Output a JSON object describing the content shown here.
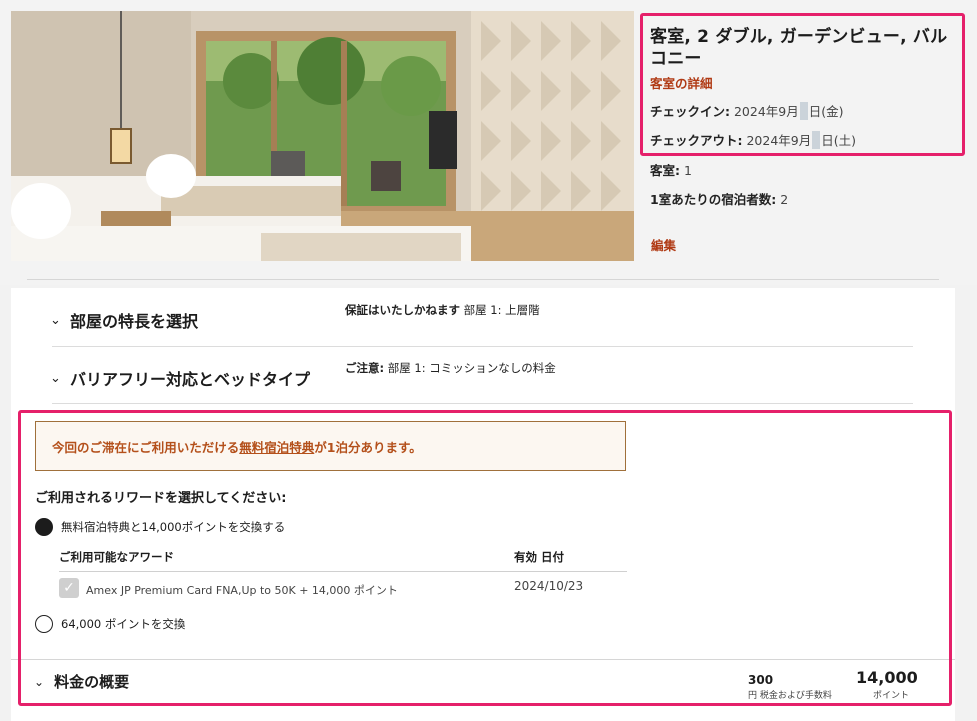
{
  "room": {
    "title": "客室, 2 ダブル, ガーデンビュー, バルコニー",
    "details_link": "客室の詳細",
    "checkin_label": "チェックイン:",
    "checkin_value_a": "2024年9月",
    "checkin_value_b": "日(金)",
    "checkout_label": "チェックアウト:",
    "checkout_value_a": "2024年9月",
    "checkout_value_b": "日(土)",
    "rooms_label": "客室:",
    "rooms_value": "1",
    "guests_label": "1室あたりの宿泊者数:",
    "guests_value": "2",
    "edit_link": "編集"
  },
  "accordion": {
    "features_title": "部屋の特長を選択",
    "features_note_label": "保証はいたしかねます",
    "features_note_value": "部屋 1: 上層階",
    "accessibility_title": "バリアフリー対応とベッドタイプ",
    "accessibility_note_label": "ご注意:",
    "accessibility_note_value": "部屋 1: コミッションなしの料金"
  },
  "rewards": {
    "notice_prefix": "今回のご滞在にご利用いただける",
    "notice_link": "無料宿泊特典",
    "notice_suffix": "が1泊分あります。",
    "question": "ご利用されるリワードを選択してください:",
    "option1_label": "無料宿泊特典と14,000ポイントを交換する",
    "option1_selected": true,
    "awards_header": "ご利用可能なアワード",
    "expiry_header": "有効 日付",
    "award_name": "Amex JP Premium Card FNA,Up to 50K + 14,000 ポイント",
    "award_expiry": "2024/10/23",
    "option2_label": "64,000 ポイントを交換",
    "option2_selected": false
  },
  "summary": {
    "title": "料金の概要",
    "tax_amount": "300",
    "tax_label": "円 税金および手数料",
    "points_amount": "14,000",
    "points_label": "ポイント"
  },
  "colors": {
    "accent_link": "#b03a14",
    "highlight": "#e5206a",
    "notice_border": "#a0703b",
    "notice_text": "#b4501b"
  },
  "icons": [
    "chevron-down-icon",
    "radio-selected-icon",
    "radio-empty-icon",
    "checkmark-icon"
  ]
}
